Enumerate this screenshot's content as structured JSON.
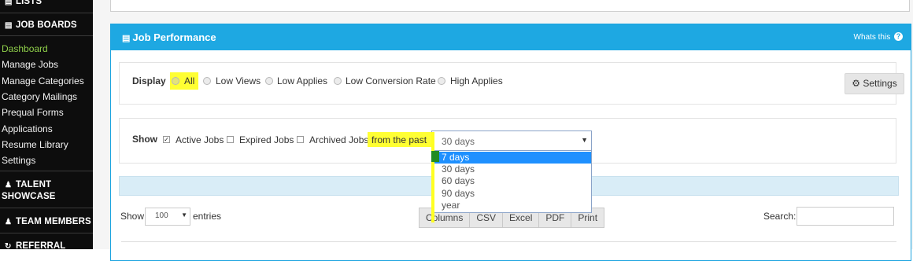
{
  "sidebar": {
    "sections": [
      {
        "icon": "list-icon",
        "label": "LISTS"
      },
      {
        "icon": "clipboard-icon",
        "label": "JOB BOARDS"
      },
      {
        "icon": "user-icon",
        "label": "TALENT SHOWCASE"
      },
      {
        "icon": "user-icon",
        "label": "TEAM MEMBERS"
      },
      {
        "icon": "refresh-icon",
        "label": "REFERRAL"
      }
    ],
    "items": [
      {
        "label": "Dashboard",
        "active": true
      },
      {
        "label": "Manage Jobs"
      },
      {
        "label": "Manage Categories"
      },
      {
        "label": "Category Mailings"
      },
      {
        "label": "Prequal Forms"
      },
      {
        "label": "Applications"
      },
      {
        "label": "Resume Library"
      },
      {
        "label": "Settings"
      }
    ],
    "talent_line1": "TALENT",
    "talent_line2": "SHOWCASE"
  },
  "panel": {
    "title": "Job Performance",
    "help_label": "Whats this"
  },
  "display": {
    "label": "Display",
    "options": [
      "All",
      "Low Views",
      "Low Applies",
      "Low Conversion Rate",
      "High Applies"
    ],
    "selected": "All"
  },
  "settings_button": "Settings",
  "show": {
    "label": "Show",
    "checkboxes": [
      {
        "label": "Active Jobs",
        "checked": true
      },
      {
        "label": "Expired Jobs",
        "checked": false
      },
      {
        "label": "Archived Jobs",
        "checked": false
      }
    ],
    "from_label": "from the past",
    "select_value": "30 days",
    "dropdown_options": [
      "7 days",
      "30 days",
      "60 days",
      "90 days",
      "year"
    ],
    "dropdown_highlighted": "7 days"
  },
  "table_controls": {
    "show_label": "Show",
    "entries_value": "100",
    "entries_label": "entries",
    "buttons": [
      "Columns",
      "CSV",
      "Excel",
      "PDF",
      "Print"
    ],
    "search_label": "Search:"
  },
  "colors": {
    "accent": "#1ea8e2",
    "highlight": "#ffff33",
    "sidebar_bg": "#0d0d0d",
    "active_link": "#8fcf4a",
    "dropdown_selected": "#1e90ff"
  }
}
